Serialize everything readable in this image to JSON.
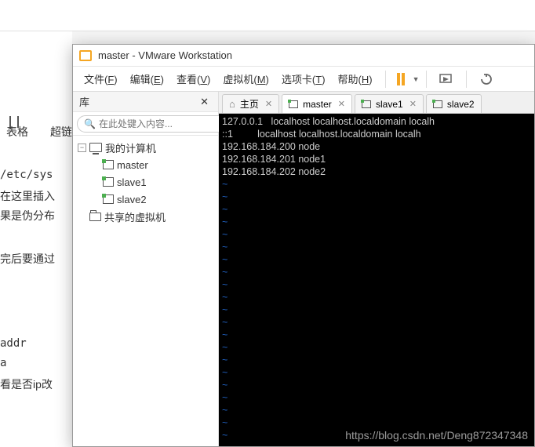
{
  "background": {
    "toolbar": {
      "tables": "表格",
      "cross": "超链"
    },
    "texts": {
      "t1": " /etc/sys",
      "t2": "在这里插入",
      "t3": "果是伪分布",
      "t4": "完后要通过",
      "t5": " addr",
      "t6": " a",
      "t7": "看是否ip改"
    }
  },
  "window": {
    "title": "master - VMware Workstation",
    "menus": {
      "file": "文件(",
      "file_u": "F",
      "file_e": ")",
      "edit": "编辑(",
      "edit_u": "E",
      "edit_e": ")",
      "view": "查看(",
      "view_u": "V",
      "view_e": ")",
      "vm": "虚拟机(",
      "vm_u": "M",
      "vm_e": ")",
      "tabs": "选项卡(",
      "tabs_u": "T",
      "tabs_e": ")",
      "help": "帮助(",
      "help_u": "H",
      "help_e": ")"
    }
  },
  "sidebar": {
    "title": "库",
    "search_placeholder": "在此处键入内容...",
    "nodes": {
      "root": "我的计算机",
      "vm1": "master",
      "vm2": "slave1",
      "vm3": "slave2",
      "shared": "共享的虚拟机"
    }
  },
  "tabs": {
    "home": "主页",
    "t1": "master",
    "t2": "slave1",
    "t3": "slave2"
  },
  "terminal": {
    "l1": "127.0.0.1   localhost localhost.localdomain localh",
    "l2": "::1         localhost localhost.localdomain localh",
    "l3": "192.168.184.200 node",
    "l4": "192.168.184.201 node1",
    "l5": "192.168.184.202 node2"
  },
  "watermark": "https://blog.csdn.net/Deng872347348"
}
